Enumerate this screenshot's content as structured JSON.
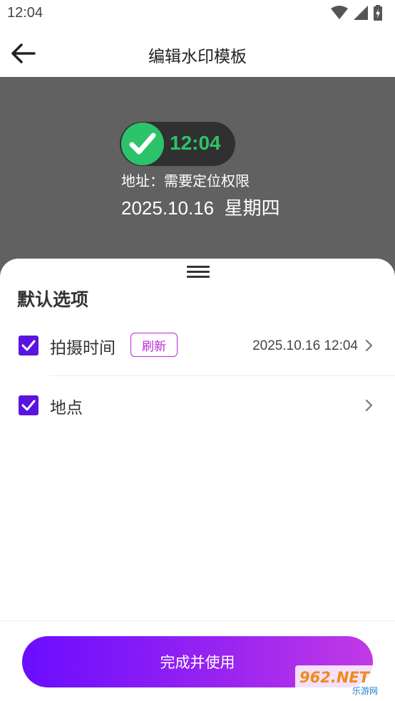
{
  "status_bar": {
    "time": "12:04"
  },
  "app_bar": {
    "title": "编辑水印模板"
  },
  "preview": {
    "time": "12:04",
    "address": "地址：需要定位权限",
    "date": "2025.10.16",
    "weekday": "星期四"
  },
  "sheet": {
    "section_title": "默认选项",
    "rows": [
      {
        "label": "拍摄时间",
        "tag": "刷新",
        "value": "2025.10.16  12:04",
        "checked": true
      },
      {
        "label": "地点",
        "value": "",
        "checked": true
      }
    ]
  },
  "footer": {
    "button_label": "完成并使用"
  },
  "watermark": {
    "text": "962.NET",
    "subtext": "乐游网"
  },
  "colors": {
    "accent": "#5b14e0",
    "tag": "#b62ad6",
    "success": "#2cc36b",
    "preview_bg": "#616161",
    "gradient_start": "#6a0dff",
    "gradient_end": "#c13ae5"
  }
}
